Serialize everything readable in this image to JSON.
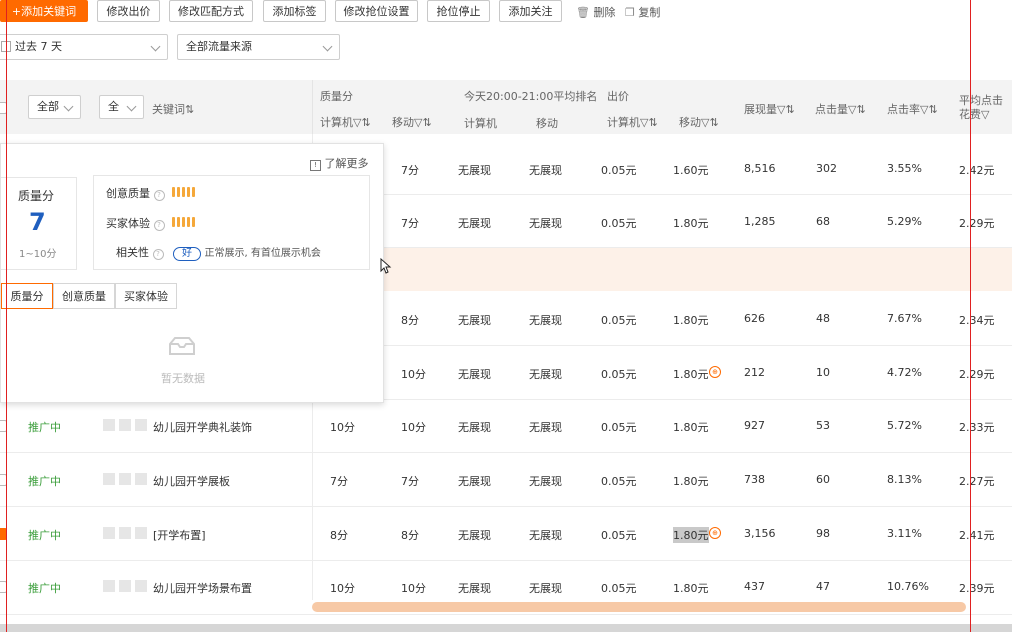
{
  "toolbar": {
    "add_keyword": "+添加关键词",
    "modify_bid": "修改出价",
    "modify_match": "修改匹配方式",
    "add_tag": "添加标签",
    "modify_grab": "修改抢位设置",
    "stop_grab": "抢位停止",
    "add_follow": "添加关注",
    "delete": "删除",
    "copy": "复制"
  },
  "filters": {
    "date": "过去 7 天",
    "source": "全部流量来源"
  },
  "header": {
    "all1": "全部",
    "all2": "全",
    "keyword": "关键词⇅",
    "quality": "质量分",
    "q_pc": "计算机▽⇅",
    "q_mobile": "移动▽⇅",
    "rank_group": "今天20:00-21:00平均排名",
    "rank_pc": "计算机",
    "rank_mobile": "移动",
    "bid": "出价",
    "bid_pc": "计算机▽⇅",
    "bid_mobile": "移动▽⇅",
    "impressions": "展现量▽⇅",
    "clicks": "点击量▽⇅",
    "ctr": "点击率▽⇅",
    "avg_cost_1": "平均点击",
    "avg_cost_2": "花费▽"
  },
  "rows": [
    {
      "status": "",
      "keyword": "",
      "q_pc": "",
      "q_mobile": "7分",
      "rank_pc": "无展现",
      "rank_mobile": "无展现",
      "bid_pc": "0.05元",
      "bid_mobile": "1.60元",
      "impressions": "8,516",
      "clicks": "302",
      "ctr": "3.55%",
      "avg": "2.42元"
    },
    {
      "status": "",
      "keyword": "",
      "q_pc": "",
      "q_mobile": "7分",
      "rank_pc": "无展现",
      "rank_mobile": "无展现",
      "bid_pc": "0.05元",
      "bid_mobile": "1.80元",
      "impressions": "1,285",
      "clicks": "68",
      "ctr": "5.29%",
      "avg": "2.29元"
    },
    {
      "status": "",
      "keyword": "",
      "q_pc": "",
      "q_mobile": "8分",
      "rank_pc": "无展现",
      "rank_mobile": "无展现",
      "bid_pc": "0.05元",
      "bid_mobile": "1.80元",
      "impressions": "626",
      "clicks": "48",
      "ctr": "7.67%",
      "avg": "2.34元"
    },
    {
      "status": "",
      "keyword": "",
      "q_pc": "",
      "q_mobile": "10分",
      "rank_pc": "无展现",
      "rank_mobile": "无展现",
      "bid_pc": "0.05元",
      "bid_mobile": "1.80元",
      "impressions": "212",
      "clicks": "10",
      "ctr": "4.72%",
      "avg": "2.29元"
    },
    {
      "status": "推广中",
      "keyword": "幼儿园开学典礼装饰",
      "q_pc": "10分",
      "q_mobile": "10分",
      "rank_pc": "无展现",
      "rank_mobile": "无展现",
      "bid_pc": "0.05元",
      "bid_mobile": "1.80元",
      "impressions": "927",
      "clicks": "53",
      "ctr": "5.72%",
      "avg": "2.33元"
    },
    {
      "status": "推广中",
      "keyword": "幼儿园开学展板",
      "q_pc": "7分",
      "q_mobile": "7分",
      "rank_pc": "无展现",
      "rank_mobile": "无展现",
      "bid_pc": "0.05元",
      "bid_mobile": "1.80元",
      "impressions": "738",
      "clicks": "60",
      "ctr": "8.13%",
      "avg": "2.27元"
    },
    {
      "status": "推广中",
      "keyword": "[开学布置]",
      "q_pc": "8分",
      "q_mobile": "8分",
      "rank_pc": "无展现",
      "rank_mobile": "无展现",
      "bid_pc": "0.05元",
      "bid_mobile": "1.80元",
      "impressions": "3,156",
      "clicks": "98",
      "ctr": "3.11%",
      "avg": "2.41元"
    },
    {
      "status": "推广中",
      "keyword": "幼儿园开学场景布置",
      "q_pc": "10分",
      "q_mobile": "10分",
      "rank_pc": "无展现",
      "rank_mobile": "无展现",
      "bid_pc": "0.05元",
      "bid_mobile": "1.80元",
      "impressions": "437",
      "clicks": "47",
      "ctr": "10.76%",
      "avg": "2.39元"
    }
  ],
  "popover": {
    "learn_more": "了解更多",
    "score_title": "质量分",
    "score_value": "7",
    "score_range": "1~10分",
    "creative_quality": "创意质量",
    "buyer_experience": "买家体验",
    "relevance": "相关性",
    "relevance_badge": "好",
    "relevance_desc": "正常展示, 有首位展示机会",
    "tab_quality": "质量分",
    "tab_creative": "创意质量",
    "tab_buyer": "买家体验",
    "empty": "暂无数据"
  },
  "colors": {
    "accent": "#ff6a00",
    "status_green": "#3a9d3a",
    "score_blue": "#1f5fbf",
    "scrollbar": "#f7c9a6"
  }
}
